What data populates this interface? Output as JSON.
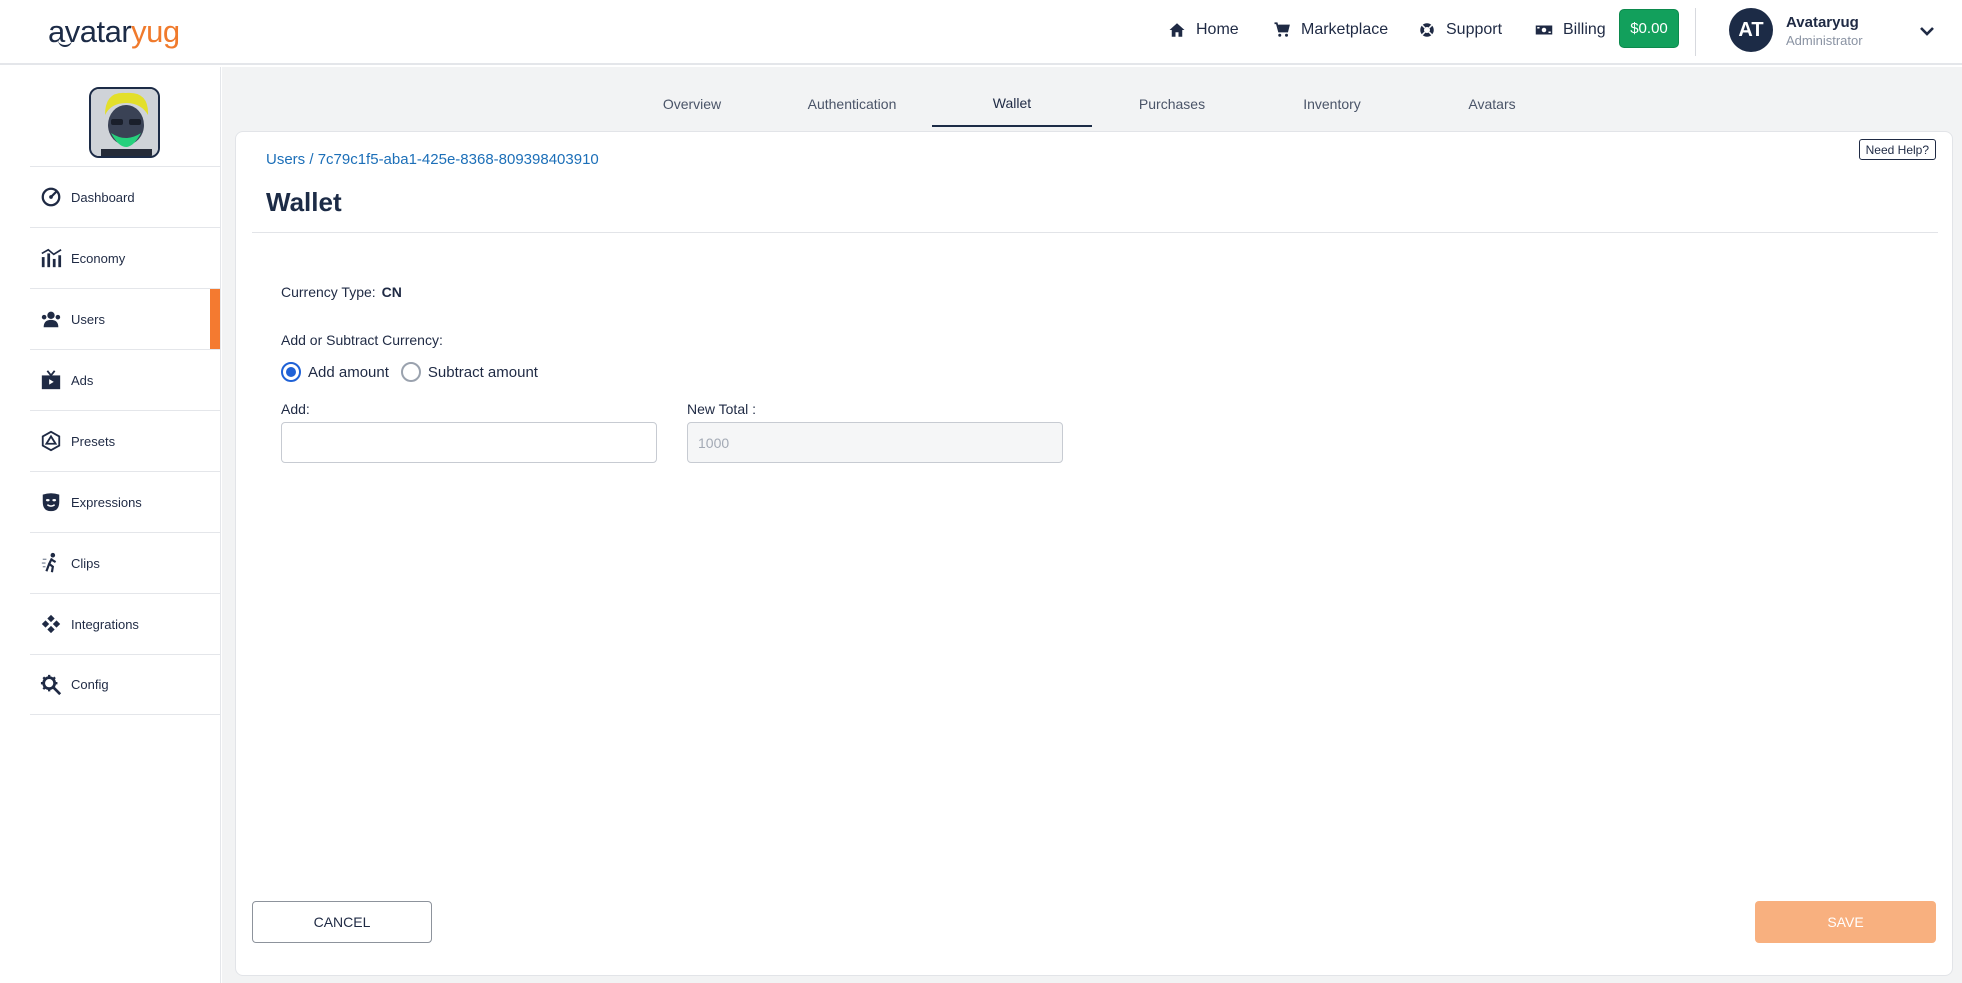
{
  "header": {
    "logo_part1": "avatar",
    "logo_part2": "yug",
    "nav": [
      {
        "label": "Home",
        "icon": "home-icon"
      },
      {
        "label": "Marketplace",
        "icon": "cart-icon"
      },
      {
        "label": "Support",
        "icon": "support-icon"
      },
      {
        "label": "Billing",
        "icon": "billing-icon"
      }
    ],
    "balance": "$0.00",
    "user": {
      "initials": "AT",
      "name": "Avataryug",
      "role": "Administrator"
    }
  },
  "sidebar": {
    "items": [
      {
        "label": "Dashboard",
        "icon": "dashboard-icon",
        "active": false
      },
      {
        "label": "Economy",
        "icon": "economy-icon",
        "active": false
      },
      {
        "label": "Users",
        "icon": "users-icon",
        "active": true
      },
      {
        "label": "Ads",
        "icon": "ads-icon",
        "active": false
      },
      {
        "label": "Presets",
        "icon": "presets-icon",
        "active": false
      },
      {
        "label": "Expressions",
        "icon": "expressions-icon",
        "active": false
      },
      {
        "label": "Clips",
        "icon": "clips-icon",
        "active": false
      },
      {
        "label": "Integrations",
        "icon": "integrations-icon",
        "active": false
      },
      {
        "label": "Config",
        "icon": "config-icon",
        "active": false
      }
    ]
  },
  "tabs": [
    {
      "label": "Overview",
      "active": false
    },
    {
      "label": "Authentication",
      "active": false
    },
    {
      "label": "Wallet",
      "active": true
    },
    {
      "label": "Purchases",
      "active": false
    },
    {
      "label": "Inventory",
      "active": false
    },
    {
      "label": "Avatars",
      "active": false
    }
  ],
  "panel": {
    "help": "Need Help?",
    "breadcrumb_root": "Users",
    "breadcrumb_sep": " / ",
    "breadcrumb_id": "7c79c1f5-aba1-425e-8368-809398403910",
    "title": "Wallet",
    "currency_type_label": "Currency Type:",
    "currency_type_value": "CN",
    "adjust_label": "Add or Subtract Currency:",
    "radio_add": "Add amount",
    "radio_subtract": "Subtract amount",
    "selected_mode": "add",
    "add_label": "Add:",
    "add_value": "",
    "new_total_label": "New Total :",
    "new_total_placeholder": "1000",
    "cancel": "CANCEL",
    "save": "SAVE"
  },
  "colors": {
    "brand_dark": "#1c2b46",
    "brand_orange": "#f47a30",
    "balance_green": "#12a05c",
    "link_blue": "#1c6fb8",
    "radio_blue": "#1f61d6",
    "save_disabled": "#f8b07f"
  }
}
